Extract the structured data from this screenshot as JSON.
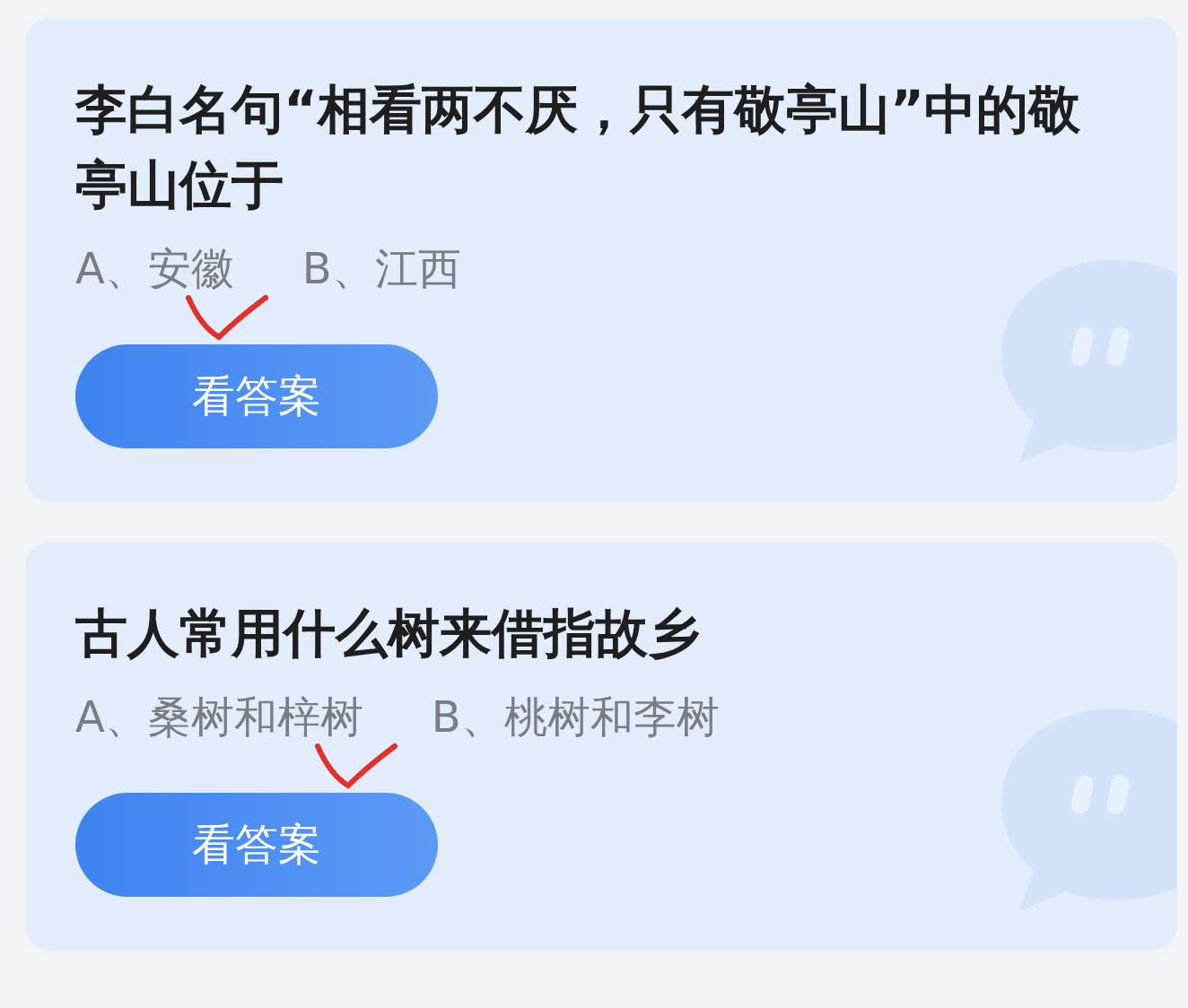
{
  "cards": [
    {
      "question": "李白名句“相看两不厌，只有敬亭山”中的敬亭山位于",
      "options": [
        {
          "text": "A、安徽",
          "marked": true
        },
        {
          "text": "B、江西",
          "marked": false
        }
      ],
      "button": "看答案"
    },
    {
      "question": "古人常用什么树来借指故乡",
      "options": [
        {
          "text": "A、桑树和梓树",
          "marked": true
        },
        {
          "text": "B、桃树和李树",
          "marked": false
        }
      ],
      "button": "看答案"
    }
  ]
}
